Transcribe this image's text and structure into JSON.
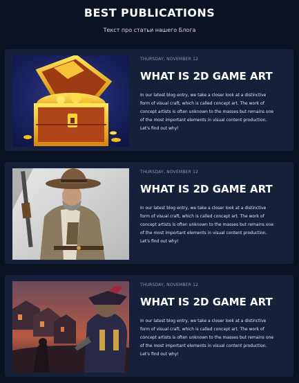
{
  "header": {
    "title": "BEST PUBLICATIONS",
    "subtitle": "Текст про статьи нашего Блога"
  },
  "colors": {
    "background": "#0b1222",
    "card": "#16203a",
    "title_text": "#ffffff",
    "date_text": "#8e96a8"
  },
  "posts": [
    {
      "date": "THURSDAY, NOVEMBER 12",
      "title": "WHAT IS 2D GAME ART",
      "excerpt": "In our latest blog entry, we take a closer look at a distinctive form of visual craft, which is called concept art. The work of concept artists is often unknown to the masses but remains one of the most important elements in visual content production. Let's find out why!",
      "image_icon": "treasure-chest-illustration"
    },
    {
      "date": "THURSDAY, NOVEMBER 12",
      "title": "WHAT IS 2D GAME ART",
      "excerpt": "In our latest blog entry, we take a closer look at a distinctive form of visual craft, which is called concept art. The work of concept artists is often unknown to the masses but remains one of the most important elements in visual content production. Let's find out why!",
      "image_icon": "gunslinger-illustration"
    },
    {
      "date": "THURSDAY, NOVEMBER 12",
      "title": "WHAT IS 2D GAME ART",
      "excerpt": "In our latest blog entry, we take a closer look at a distinctive form of visual craft, which is called concept art. The work of concept artists is often unknown to the masses but remains one of the most important elements in visual content production. Let's find out why!",
      "image_icon": "dark-town-battle-illustration"
    }
  ]
}
